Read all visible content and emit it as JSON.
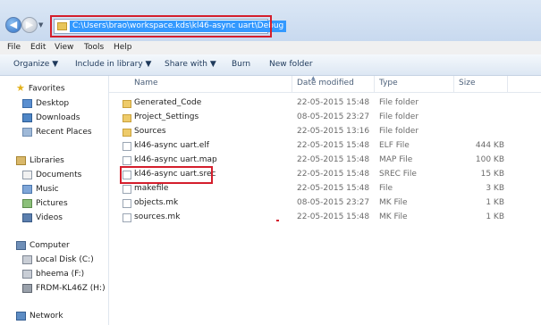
{
  "address_bar": {
    "path": "C:\\Users\\brao\\workspace.kds\\kl46-async uart\\Debug"
  },
  "menu": [
    "File",
    "Edit",
    "View",
    "Tools",
    "Help"
  ],
  "toolbar": {
    "organize": "Organize",
    "include_in_library": "Include in library",
    "share_with": "Share with",
    "burn": "Burn",
    "new_folder": "New folder"
  },
  "sidebar": {
    "favorites": "Favorites",
    "favorites_items": [
      "Desktop",
      "Downloads",
      "Recent Places"
    ],
    "libraries": "Libraries",
    "libraries_items": [
      "Documents",
      "Music",
      "Pictures",
      "Videos"
    ],
    "computer": "Computer",
    "computer_items": [
      "Local Disk (C:)",
      "bheema (F:)",
      "FRDM-KL46Z (H:)"
    ],
    "network": "Network"
  },
  "columns": {
    "name": "Name",
    "date": "Date modified",
    "type": "Type",
    "size": "Size"
  },
  "files": [
    {
      "name": "Generated_Code",
      "date": "22-05-2015 15:48",
      "type": "File folder",
      "size": "",
      "kind": "folder"
    },
    {
      "name": "Project_Settings",
      "date": "08-05-2015 23:27",
      "type": "File folder",
      "size": "",
      "kind": "folder"
    },
    {
      "name": "Sources",
      "date": "22-05-2015 13:16",
      "type": "File folder",
      "size": "",
      "kind": "folder"
    },
    {
      "name": "kl46-async uart.elf",
      "date": "22-05-2015 15:48",
      "type": "ELF File",
      "size": "444 KB",
      "kind": "file"
    },
    {
      "name": "kl46-async uart.map",
      "date": "22-05-2015 15:48",
      "type": "MAP File",
      "size": "100 KB",
      "kind": "file"
    },
    {
      "name": "kl46-async uart.srec",
      "date": "22-05-2015 15:48",
      "type": "SREC File",
      "size": "15 KB",
      "kind": "file"
    },
    {
      "name": "makefile",
      "date": "22-05-2015 15:48",
      "type": "File",
      "size": "3 KB",
      "kind": "file"
    },
    {
      "name": "objects.mk",
      "date": "08-05-2015 23:27",
      "type": "MK File",
      "size": "1 KB",
      "kind": "file"
    },
    {
      "name": "sources.mk",
      "date": "22-05-2015 15:48",
      "type": "MK File",
      "size": "1 KB",
      "kind": "file"
    }
  ],
  "colors": {
    "highlight": "#d41e2c",
    "selection": "#3399ff"
  }
}
